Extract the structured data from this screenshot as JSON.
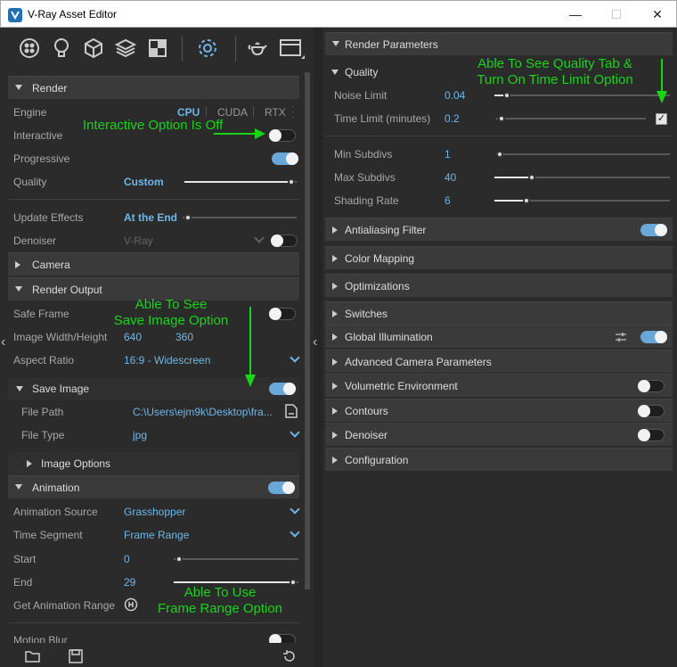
{
  "window": {
    "title": "V-Ray Asset Editor",
    "minimize": "—",
    "maximize": "☐",
    "close": "✕"
  },
  "left": {
    "render": {
      "header": "Render",
      "engine_label": "Engine",
      "engines": [
        "CPU",
        "CUDA",
        "RTX"
      ],
      "interactive_label": "Interactive",
      "progressive_label": "Progressive",
      "quality_label": "Quality",
      "quality_value": "Custom",
      "update_effects_label": "Update Effects",
      "update_effects_value": "At the End",
      "denoiser_label": "Denoiser",
      "denoiser_value": "V-Ray"
    },
    "camera": {
      "header": "Camera"
    },
    "render_output": {
      "header": "Render Output",
      "safe_frame_label": "Safe Frame",
      "size_label": "Image Width/Height",
      "width": "640",
      "height": "360",
      "aspect_label": "Aspect Ratio",
      "aspect_value": "16:9 - Widescreen"
    },
    "save_image": {
      "header": "Save Image",
      "file_path_label": "File Path",
      "file_path_value": "C:\\Users\\ejm9k\\Desktop\\fra...",
      "file_type_label": "File Type",
      "file_type_value": "jpg",
      "image_options": "Image Options"
    },
    "animation": {
      "header": "Animation",
      "source_label": "Animation Source",
      "source_value": "Grasshopper",
      "segment_label": "Time Segment",
      "segment_value": "Frame Range",
      "start_label": "Start",
      "start_value": "0",
      "end_label": "End",
      "end_value": "29",
      "get_range_label": "Get Animation Range",
      "motion_blur_label": "Motion Blur"
    }
  },
  "right": {
    "render_parameters": "Render Parameters",
    "quality": {
      "header": "Quality",
      "noise_limit_label": "Noise Limit",
      "noise_limit_value": "0.04",
      "time_limit_label": "Time Limit (minutes)",
      "time_limit_value": "0.2",
      "min_subdivs_label": "Min Subdivs",
      "min_subdivs_value": "1",
      "max_subdivs_label": "Max Subdivs",
      "max_subdivs_value": "40",
      "shading_rate_label": "Shading Rate",
      "shading_rate_value": "6"
    },
    "sections": [
      "Antialiasing Filter",
      "Color Mapping",
      "Optimizations",
      "Switches",
      "Global Illumination",
      "Advanced Camera Parameters",
      "Volumetric Environment",
      "Contours",
      "Denoiser",
      "Configuration"
    ]
  },
  "annotations": {
    "interactive": "Interactive Option Is Off",
    "save_image": "Able To See\nSave Image Option",
    "quality": "Able To See Quality Tab &\nTurn On Time Limit Option",
    "frame_range": "Able To Use\nFrame Range Option"
  },
  "colors": {
    "accent": "#6fb7e8",
    "annotation": "#19d419",
    "panel": "#2b2b2b",
    "section": "#3a3a3a"
  }
}
